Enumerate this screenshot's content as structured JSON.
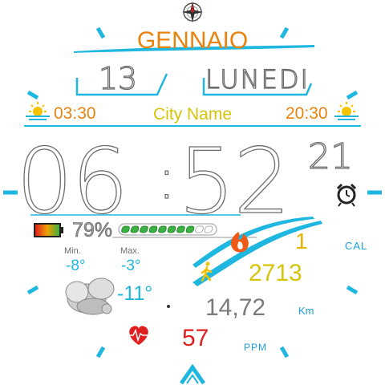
{
  "date": {
    "month": "GENNAIO",
    "day_number": "13",
    "weekday": "LUNEDI"
  },
  "sun": {
    "sunrise": "03:30",
    "sunset": "20:30",
    "city": "City Name"
  },
  "time": {
    "hours": "06",
    "minutes": "52",
    "seconds": "21",
    "separator": ":"
  },
  "battery": {
    "percent_text": "79%",
    "level": 0.79
  },
  "weather": {
    "min_label": "Min.",
    "max_label": "Max.",
    "temp_min": "-8°",
    "temp_max": "-3°",
    "temp_now": "-11°",
    "condition_icon": "cloud-icon"
  },
  "activity": {
    "calories": "1",
    "calories_unit": "CAL",
    "steps": "2713",
    "distance": "14,72",
    "distance_unit": "Km",
    "heart_rate": "57",
    "heart_rate_unit": "PPM"
  },
  "colors": {
    "accent": "#1fb6e0",
    "orange": "#e8840e",
    "yellow": "#d6c40a",
    "red": "#e02020"
  }
}
